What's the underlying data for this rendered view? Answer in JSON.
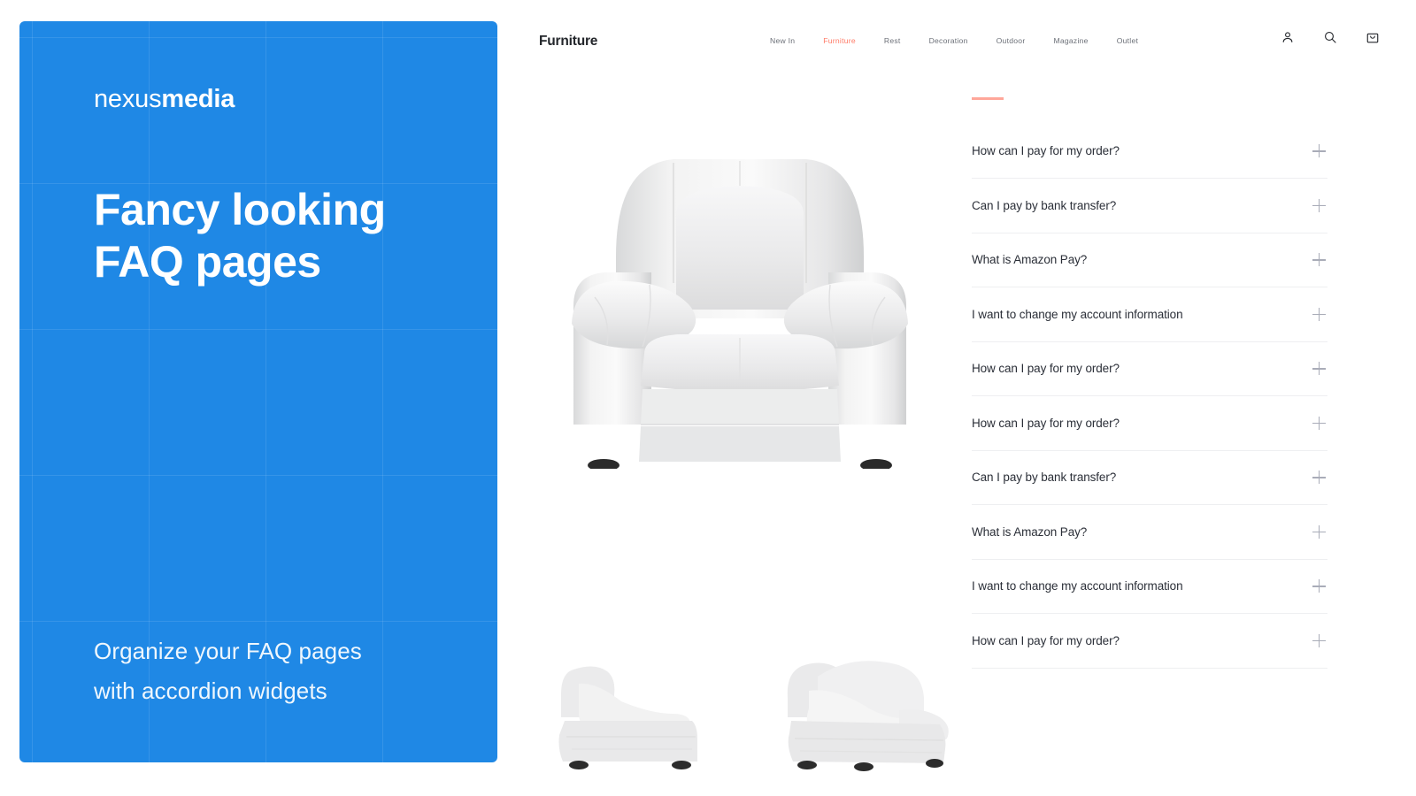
{
  "promo": {
    "brand_light": "nexus",
    "brand_bold": "media",
    "headline_line1": "Fancy looking",
    "headline_line2": "FAQ pages",
    "sub_line1": "Organize your FAQ pages",
    "sub_line2": "with accordion widgets",
    "bg_color": "#1f88e5"
  },
  "site": {
    "logo": "Furniture",
    "nav": [
      {
        "label": "New In",
        "active": false
      },
      {
        "label": "Furniture",
        "active": true
      },
      {
        "label": "Rest",
        "active": false
      },
      {
        "label": "Decoration",
        "active": false
      },
      {
        "label": "Outdoor",
        "active": false
      },
      {
        "label": "Magazine",
        "active": false
      },
      {
        "label": "Outlet",
        "active": false
      }
    ],
    "active_color": "#ff7a66",
    "icons": [
      "account-icon",
      "search-icon",
      "cart-icon"
    ],
    "gallery": {
      "main_alt": "white-leather-armchair-front-view",
      "thumbnails": [
        "white-leather-armchair-side-view",
        "white-leather-armchair-angled-view"
      ]
    },
    "faq": {
      "accent_color": "#ffa79a",
      "items": [
        {
          "question": "How can I pay for my order?",
          "toggle": "plus-icon"
        },
        {
          "question": "Can I pay by bank transfer?",
          "toggle": "plus-icon"
        },
        {
          "question": "What is Amazon Pay?",
          "toggle": "plus-icon"
        },
        {
          "question": "I want to change my account information",
          "toggle": "plus-icon"
        },
        {
          "question": "How can I pay for my order?",
          "toggle": "plus-icon"
        },
        {
          "question": "How can I pay for my order?",
          "toggle": "plus-icon"
        },
        {
          "question": "Can I pay by bank transfer?",
          "toggle": "plus-icon"
        },
        {
          "question": "What is Amazon Pay?",
          "toggle": "plus-icon"
        },
        {
          "question": "I want to change my account information",
          "toggle": "plus-icon"
        },
        {
          "question": "How can I pay for my order?",
          "toggle": "plus-icon"
        }
      ]
    }
  }
}
